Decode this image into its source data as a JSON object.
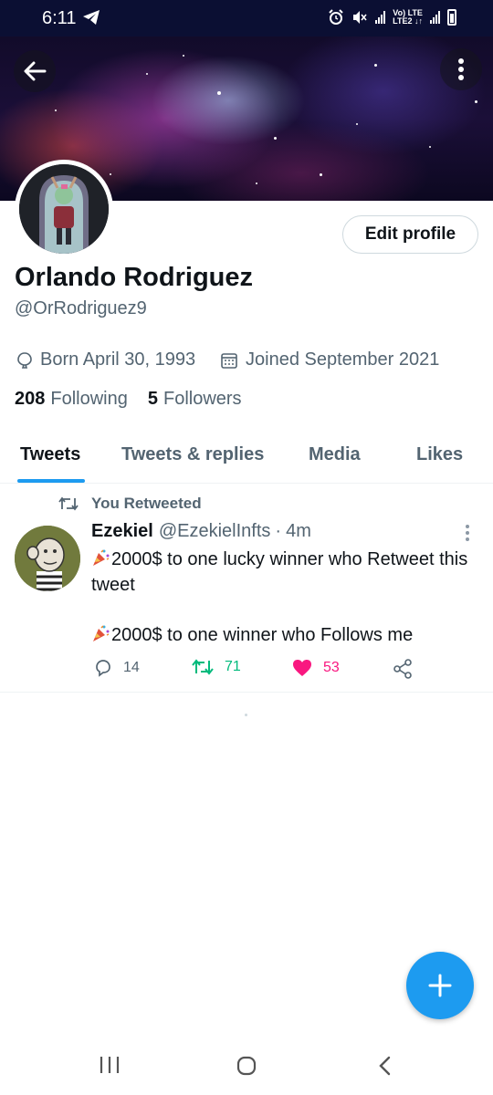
{
  "status_bar": {
    "time": "6:11",
    "network": "Vo) LTE\nLTE2"
  },
  "profile": {
    "display_name": "Orlando Rodriguez",
    "handle": "@OrRodriguez9",
    "edit_button": "Edit profile",
    "born": "Born April 30, 1993",
    "joined": "Joined September 2021",
    "following_count": "208",
    "following_label": "Following",
    "followers_count": "5",
    "followers_label": "Followers"
  },
  "tabs": [
    {
      "label": "Tweets",
      "active": true
    },
    {
      "label": "Tweets & replies",
      "active": false
    },
    {
      "label": "Media",
      "active": false
    },
    {
      "label": "Likes",
      "active": false
    }
  ],
  "tweet": {
    "context": "You Retweeted",
    "author": "Ezekiel",
    "handle": "@EzekielInfts",
    "separator": "·",
    "time": "4m",
    "line1": "2000$ to one lucky winner who Retweet this tweet",
    "line2": "2000$ to one winner who Follows me",
    "replies": "14",
    "retweets": "71",
    "likes": "53"
  },
  "colors": {
    "accent": "#1d9bf0",
    "retweet": "#00ba7c",
    "like": "#f91880",
    "secondary_text": "#536471"
  }
}
